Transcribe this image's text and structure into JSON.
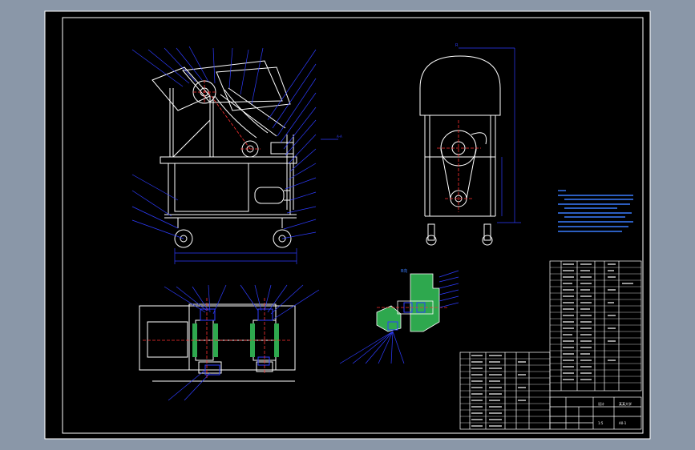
{
  "window": {
    "background": "#8a97a8",
    "sheet": "#000000"
  },
  "colors": {
    "outline": "#ffffff",
    "leader": "#2e3cff",
    "part": "#ffffff",
    "center": "#ff3030",
    "hatch": "#2ea84e",
    "dim": "#2e3cff",
    "note": "#3a7dff"
  },
  "labels": {
    "section_tag_right": "A-A",
    "detail_tag": "B向",
    "title_block_name": "设计",
    "title_block_org": "某某大学",
    "sheet_no": "A0-1",
    "scale": "1:5"
  }
}
